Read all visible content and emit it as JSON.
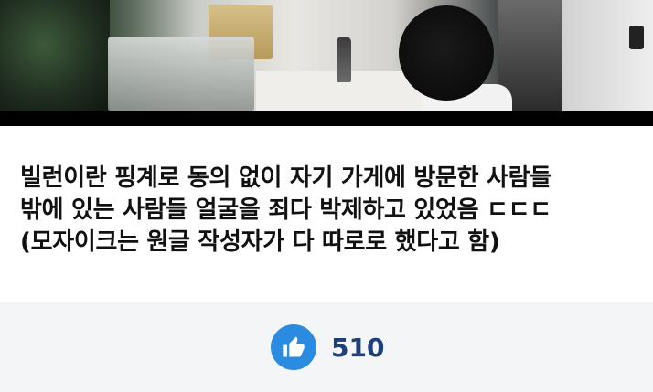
{
  "post": {
    "caption_lines": [
      "빌런이란 핑계로 동의 없이 자기 가게에 방문한 사람들",
      "밖에 있는 사람들 얼굴을 죄다 박제하고 있었음 ㄷㄷㄷ",
      "(모자이크는 원글 작성자가 다 따로로 했다고 함)"
    ]
  },
  "reactions": {
    "like_icon": "thumbs-up-icon",
    "like_count": "510",
    "like_color": "#2a8be0",
    "count_color": "#1f3f7a"
  },
  "colors": {
    "footer_bg": "#f4f5f7",
    "photo_divider": "#000000"
  }
}
